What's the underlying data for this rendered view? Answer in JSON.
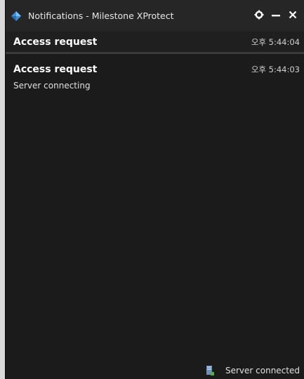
{
  "window": {
    "title": "Notifications - Milestone XProtect",
    "icon": "milestone-diamond-icon",
    "controls": {
      "settings_icon": "gear-icon",
      "minimize_icon": "minimize-icon",
      "close_icon": "close-icon"
    }
  },
  "notifications": [
    {
      "title": "Access request",
      "time": "오후 5:44:04",
      "body": ""
    },
    {
      "title": "Access request",
      "time": "오후 5:44:03",
      "body": "Server connecting"
    }
  ],
  "status": {
    "icon": "server-icon",
    "text": "Server connected"
  },
  "colors": {
    "background": "#1b1b1b",
    "titlebar": "#262626",
    "accent": "#3f8fd8"
  }
}
